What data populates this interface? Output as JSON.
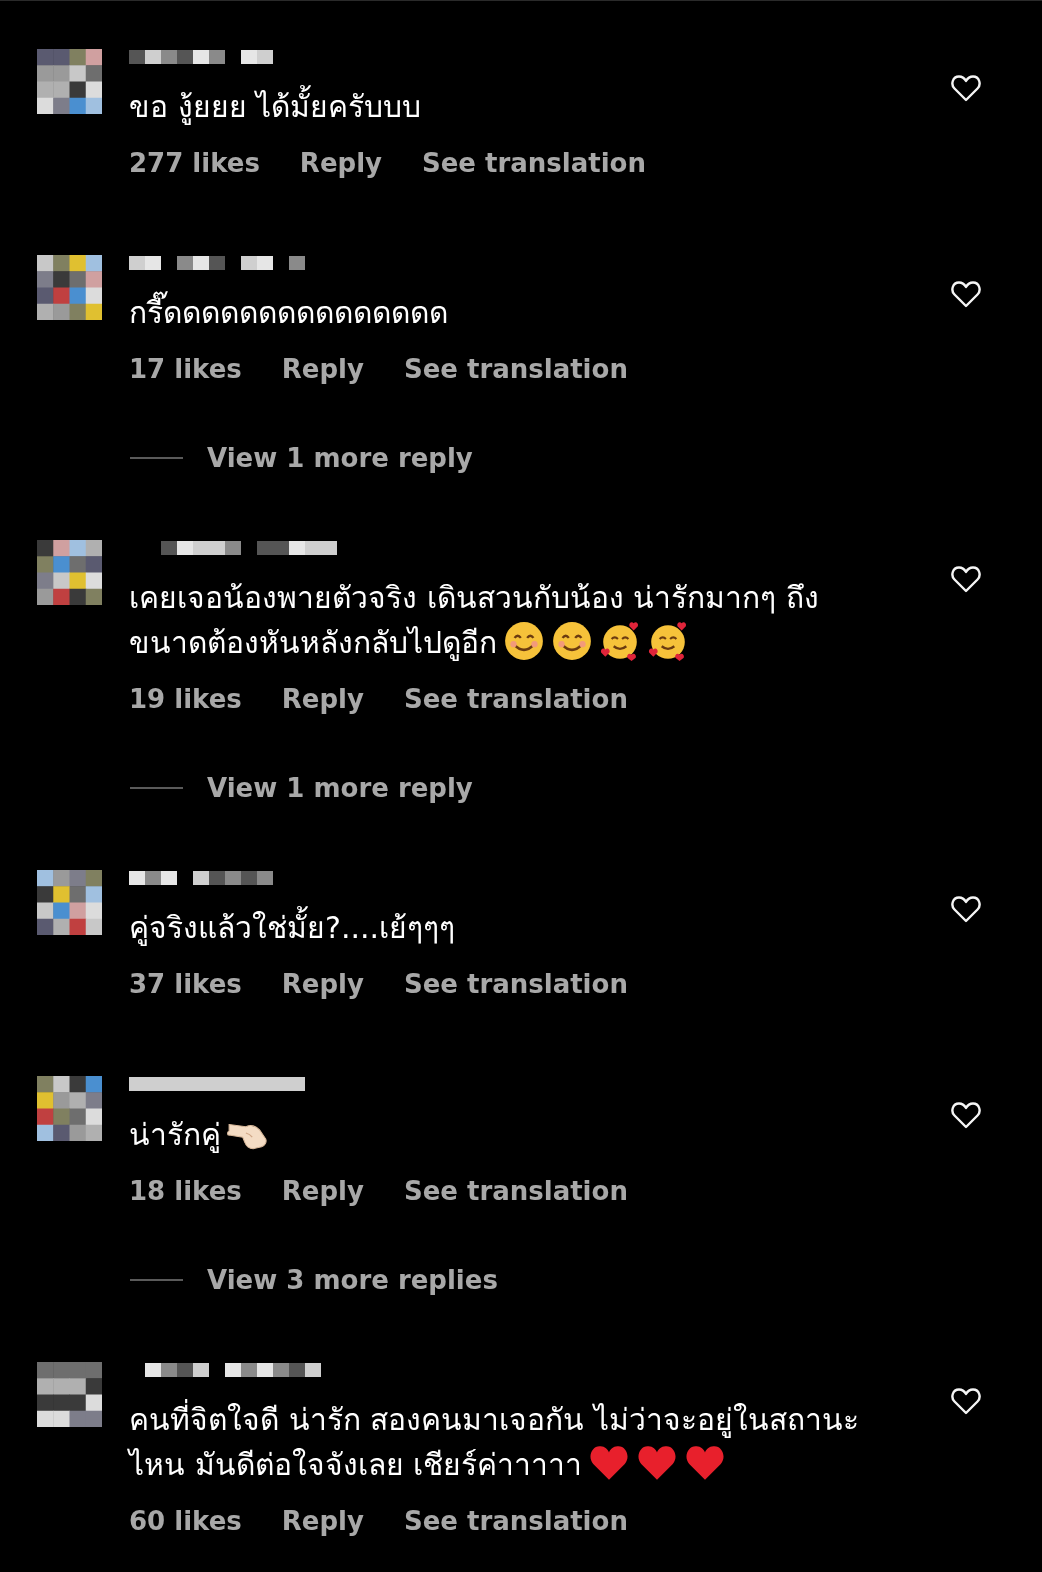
{
  "comments": [
    {
      "text": "ขอ งู้ยยย ได้มั้ยครับบบ",
      "likes": "277 likes",
      "reply": "Reply",
      "translate": "See translation",
      "liked": false
    },
    {
      "text": "กรี๊ดดดดดดดดดดดดดดด",
      "likes": "17 likes",
      "reply": "Reply",
      "translate": "See translation",
      "liked": false,
      "view_more": "View 1 more reply"
    },
    {
      "text": "เคยเจอน้องพายตัวจริง เดินสวนกับน้อง น่ารักมากๆ ถึงขนาดต้องหันหลังกลับไปดูอีก",
      "emoji": [
        {
          "kind": "smile"
        },
        {
          "kind": "smile"
        },
        {
          "kind": "hearts"
        },
        {
          "kind": "hearts"
        }
      ],
      "likes": "19 likes",
      "reply": "Reply",
      "translate": "See translation",
      "liked": false,
      "view_more": "View 1 more reply"
    },
    {
      "text": "คู่จริงแล้วใช่มั้ย?....เย้ๆๆๆ",
      "likes": "37 likes",
      "reply": "Reply",
      "translate": "See translation",
      "liked": false
    },
    {
      "text": "น่ารักคู่",
      "emoji": [
        {
          "kind": "hand"
        }
      ],
      "likes": "18 likes",
      "reply": "Reply",
      "translate": "See translation",
      "liked": false,
      "view_more": "View 3 more replies"
    },
    {
      "text": "คนที่จิตใจดี น่ารัก สองคนมาเจอกัน ไม่ว่าจะอยู่ในสถานะไหน มันดีต่อใจจังเลย เชียร์ค่าาาาา",
      "emoji": [
        {
          "kind": "heart"
        },
        {
          "kind": "heart"
        },
        {
          "kind": "heart"
        }
      ],
      "likes": "60 likes",
      "reply": "Reply",
      "translate": "See translation",
      "liked": false
    }
  ]
}
